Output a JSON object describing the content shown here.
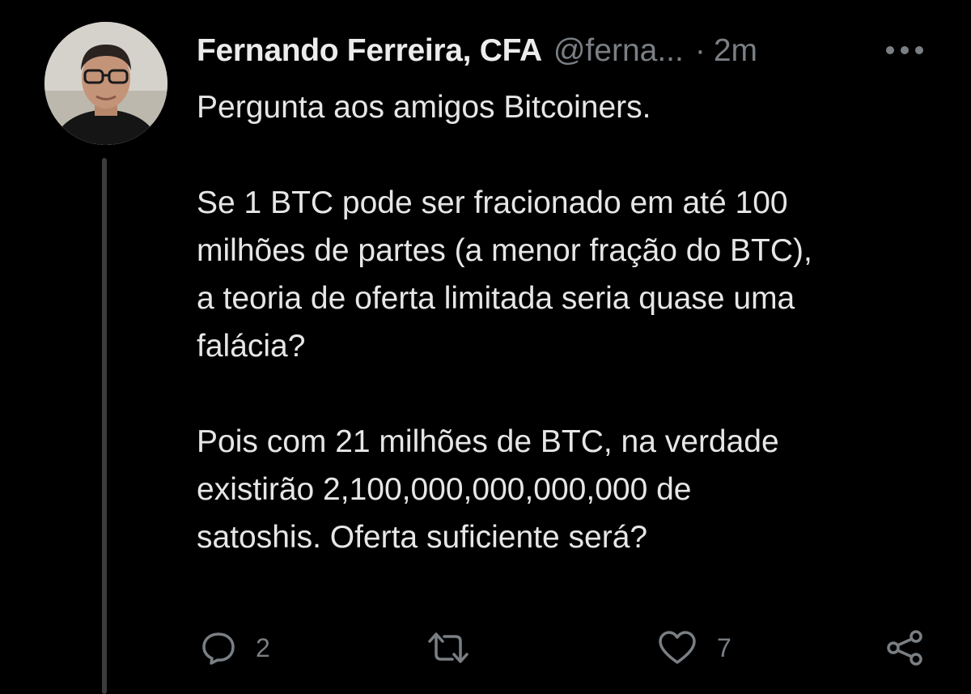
{
  "tweet": {
    "author": {
      "display_name": "Fernando Ferreira, CFA",
      "handle": "@ferna...",
      "separator": "·",
      "time": "2m"
    },
    "paragraphs": [
      "Pergunta aos amigos Bitcoiners.",
      "Se 1 BTC pode ser fracionado em até 100\nmilhões de partes (a menor fração do BTC),\na teoria de oferta limitada seria quase uma\nfalácia?",
      "Pois com 21 milhões de BTC, na verdade\nexistirão 2,100,000,000,000,000 de\nsatoshis. Oferta suficiente será?"
    ],
    "actions": {
      "reply_count": "2",
      "retweet_count": "",
      "like_count": "7"
    }
  },
  "icons": {
    "more": "more-horizontal-icon",
    "reply": "reply-icon",
    "retweet": "retweet-icon",
    "like": "heart-icon",
    "share": "share-icon"
  },
  "colors": {
    "background": "#000000",
    "text": "#e7e9ea",
    "muted": "#7a7f84",
    "thread_line": "#3a3b3d"
  }
}
